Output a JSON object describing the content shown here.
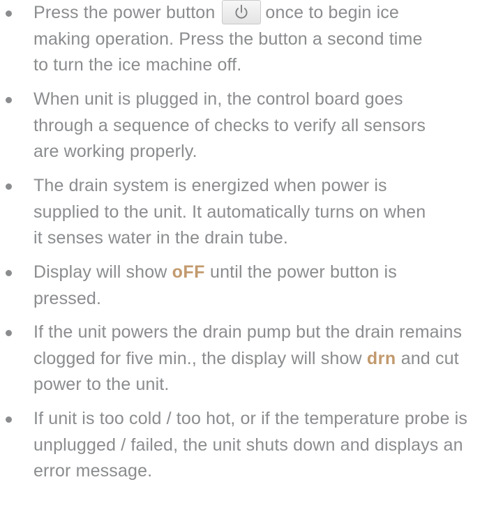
{
  "items": [
    {
      "line1_a": "Press the power button",
      "line1_b": "once to begin ice",
      "line2": "making operation. Press the button a second time",
      "line3": "to turn the ice machine off."
    },
    {
      "line1": "When unit is plugged in, the control board goes",
      "line2": "through a sequence of checks to verify all sensors",
      "line3": "are working properly."
    },
    {
      "line1": "The drain system is energized when power is",
      "line2": "supplied to the unit. It automatically turns on when",
      "line3": "it senses water in the drain tube."
    },
    {
      "line1_a": "Display will show",
      "code": "oFF",
      "line1_b": "until the power button is",
      "line2": "pressed."
    },
    {
      "line1": "If the unit powers the drain pump but the drain remains",
      "line2_a": "clogged for five min., the display will show",
      "code": "drn",
      "line2_b": "and cut",
      "line3": "power to the unit."
    },
    {
      "line1": "If unit is too cold / too hot, or if the temperature probe is",
      "line2": "unplugged / failed, the unit shuts down and displays an",
      "line3": "error message."
    }
  ],
  "icons": {
    "bullet": "bullet-dot",
    "power": "power-icon"
  },
  "colors": {
    "text": "#8a8c8e",
    "highlight": "#c29a6e"
  }
}
